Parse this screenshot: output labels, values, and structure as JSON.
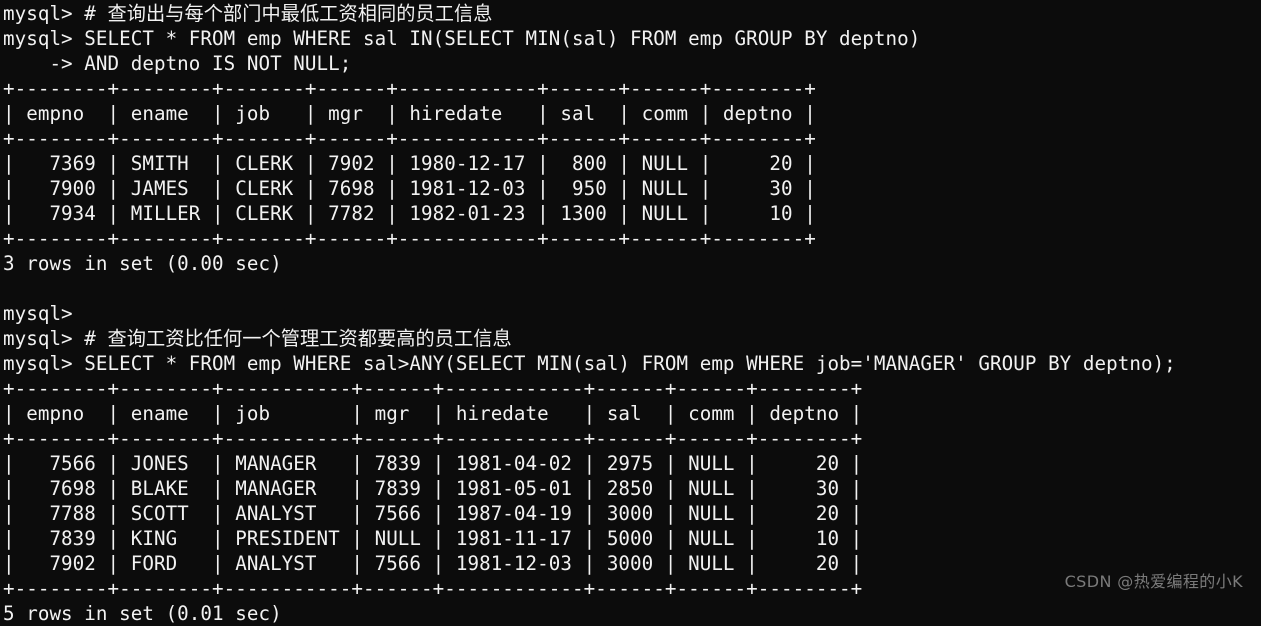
{
  "terminal": {
    "background_color": "#0c0c0c",
    "foreground_color": "#f2f2f2",
    "prompt": "mysql>",
    "continuation_prompt": "->"
  },
  "watermark": {
    "text": "CSDN @热爱编程的小K",
    "color": "#8e8e8e"
  },
  "session": {
    "blocks": [
      {
        "comment": "mysql> # 查询出与每个部门中最低工资相同的员工信息",
        "statement_line_1": "mysql> SELECT * FROM emp WHERE sal IN(SELECT MIN(sal) FROM emp GROUP BY deptno)",
        "statement_line_2": "    -> AND deptno IS NOT NULL;",
        "table": {
          "separator": "+--------+--------+-------+------+------------+------+------+--------+",
          "header": "| empno  | ename  | job   | mgr  | hiredate   | sal  | comm | deptno |",
          "rows": [
            "|   7369 | SMITH  | CLERK | 7902 | 1980-12-17 |  800 | NULL |     20 |",
            "|   7900 | JAMES  | CLERK | 7698 | 1981-12-03 |  950 | NULL |     30 |",
            "|   7934 | MILLER | CLERK | 7782 | 1982-01-23 | 1300 | NULL |     10 |"
          ]
        },
        "result_status": "3 rows in set (0.00 sec)"
      },
      {
        "empty_prompt": "mysql>",
        "comment": "mysql> # 查询工资比任何一个管理工资都要高的员工信息",
        "statement_line_1": "mysql> SELECT * FROM emp WHERE sal>ANY(SELECT MIN(sal) FROM emp WHERE job='MANAGER' GROUP BY deptno);",
        "table": {
          "separator": "+--------+--------+-----------+------+------------+------+------+--------+",
          "header": "| empno  | ename  | job       | mgr  | hiredate   | sal  | comm | deptno |",
          "rows": [
            "|   7566 | JONES  | MANAGER   | 7839 | 1981-04-02 | 2975 | NULL |     20 |",
            "|   7698 | BLAKE  | MANAGER   | 7839 | 1981-05-01 | 2850 | NULL |     30 |",
            "|   7788 | SCOTT  | ANALYST   | 7566 | 1987-04-19 | 3000 | NULL |     20 |",
            "|   7839 | KING   | PRESIDENT | NULL | 1981-11-17 | 5000 | NULL |     10 |",
            "|   7902 | FORD   | ANALYST   | 7566 | 1981-12-03 | 3000 | NULL |     20 |"
          ]
        },
        "result_status": "5 rows in set (0.01 sec)"
      }
    ],
    "blank_line": " "
  }
}
